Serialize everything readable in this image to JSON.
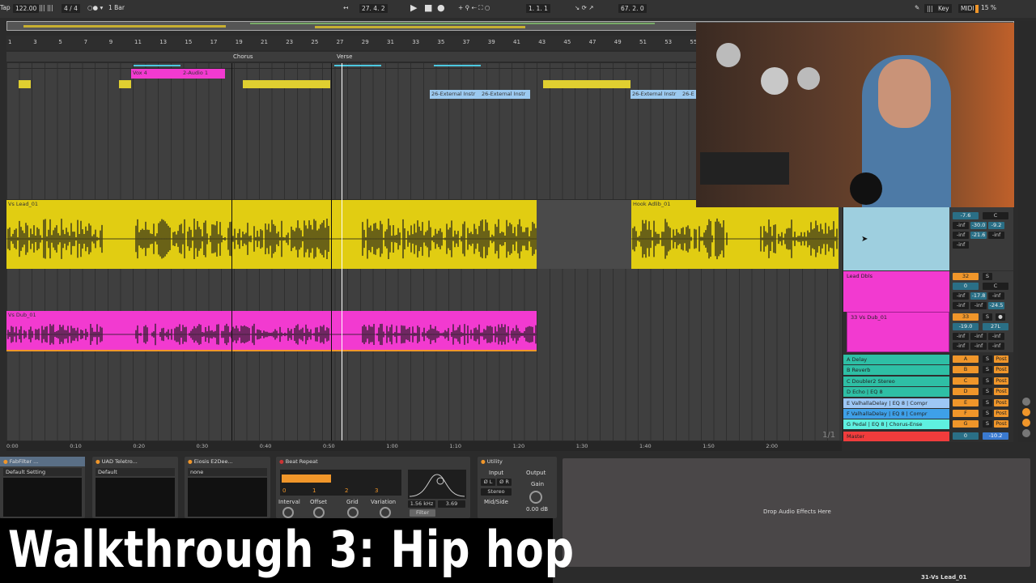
{
  "transport": {
    "tap": "Tap",
    "tempo": "122.00",
    "signature": "4 / 4",
    "quantize": "1 Bar",
    "position": "27.  4.  2",
    "loop_start": "1.  1.  1",
    "loop_length": "67.  2.  0",
    "key": "Key",
    "midi": "MIDI",
    "cpu": "15 %"
  },
  "ruler": {
    "bars": [
      "1",
      "3",
      "5",
      "7",
      "9",
      "11",
      "13",
      "15",
      "17",
      "19",
      "21",
      "23",
      "25",
      "27",
      "29",
      "31",
      "33",
      "35",
      "37",
      "39",
      "41",
      "43",
      "45",
      "47",
      "49",
      "51",
      "53",
      "55"
    ]
  },
  "locators": [
    {
      "label": "Chorus"
    },
    {
      "label": "Verse"
    }
  ],
  "clips": {
    "vox4": "Vox 4",
    "audio1": "2-Audio 1",
    "ext1": "26-External Instr",
    "ext2": "26-External Instr",
    "ext3": "26-External Instr",
    "ext4": "26-E",
    "vs_lead": "Vs Lead_01",
    "hook": "Hook Adlib_01",
    "vs_dub": "Vs Dub_01"
  },
  "mixer": {
    "top": {
      "vol": "-7.6",
      "pan": "C",
      "r1": [
        "-inf",
        "-30.0",
        "-9.2"
      ],
      "r2": [
        "-inf",
        "-21.6",
        "-inf"
      ],
      "r3": [
        "-inf"
      ]
    },
    "lead_dbls": {
      "name": "Lead Dbls",
      "num": "32",
      "solo": "S",
      "vol": "0",
      "pan": "C",
      "r1": [
        "-inf",
        "-17.8",
        "-inf"
      ],
      "r2": [
        "-inf",
        "-inf",
        "-24.5"
      ]
    },
    "vs_dub": {
      "name": "33 Vs Dub_01",
      "num": "33",
      "solo": "S",
      "vol": "-19.0",
      "pan": "27L",
      "r1": [
        "-inf",
        "-inf",
        "-inf"
      ],
      "r2": [
        "-inf",
        "-inf",
        "-inf"
      ]
    },
    "returns": [
      {
        "name": "A Delay",
        "letter": "A",
        "solo": "S",
        "post": "Post",
        "color": "#2ebfa5"
      },
      {
        "name": "B Reverb",
        "letter": "B",
        "solo": "S",
        "post": "Post",
        "color": "#2ebfa5"
      },
      {
        "name": "C Doubler2 Stereo",
        "letter": "C",
        "solo": "S",
        "post": "Post",
        "color": "#2ebfa5"
      },
      {
        "name": "D Echo | EQ 8",
        "letter": "D",
        "solo": "S",
        "post": "Post",
        "color": "#2ebfa5"
      },
      {
        "name": "E ValhallaDelay | EQ 8 | Compr",
        "letter": "E",
        "solo": "S",
        "post": "Post",
        "color": "#9dc7f5"
      },
      {
        "name": "F ValhallaDelay | EQ 8 | Compr",
        "letter": "F",
        "solo": "S",
        "post": "Post",
        "color": "#3ea0e8"
      },
      {
        "name": "G Pedal | EQ 8 | Chorus-Ense",
        "letter": "G",
        "solo": "S",
        "post": "Post",
        "color": "#5ef0e0"
      }
    ],
    "master": {
      "name": "Master",
      "vol": "0",
      "level": "-10.2"
    },
    "page": "1/1"
  },
  "timeline": [
    "0:00",
    "0:10",
    "0:20",
    "0:30",
    "0:40",
    "0:50",
    "1:00",
    "1:10",
    "1:20",
    "1:30",
    "1:40",
    "1:50",
    "2:00"
  ],
  "devices": {
    "fabfilter": {
      "title": "FabFilter ...",
      "preset": "Default Setting"
    },
    "uad": {
      "title": "UAD Teletro...",
      "preset": "Default"
    },
    "eiosis": {
      "title": "Eiosis E2Dee...",
      "preset": "none"
    },
    "beat_repeat": {
      "title": "Beat Repeat",
      "scale": [
        "0",
        "1",
        "2",
        "3"
      ],
      "interval": "Interval",
      "offset": "Offset",
      "grid": "Grid",
      "variation": "Variation",
      "freq": "1.56 kHz",
      "width": "3.69",
      "filter": "Filter",
      "progress": 0.42
    },
    "utility": {
      "title": "Utility",
      "input": "Input",
      "output": "Output",
      "phase_l": "Ø L",
      "phase_r": "Ø R",
      "mode": "Stereo",
      "midside": "Mid/Side",
      "gain": "Gain",
      "gain_value": "0.00 dB"
    },
    "drop": "Drop Audio Effects Here"
  },
  "status": {
    "track": "31-Vs Lead_01"
  },
  "banner": "Walkthrough 3: Hip hop"
}
